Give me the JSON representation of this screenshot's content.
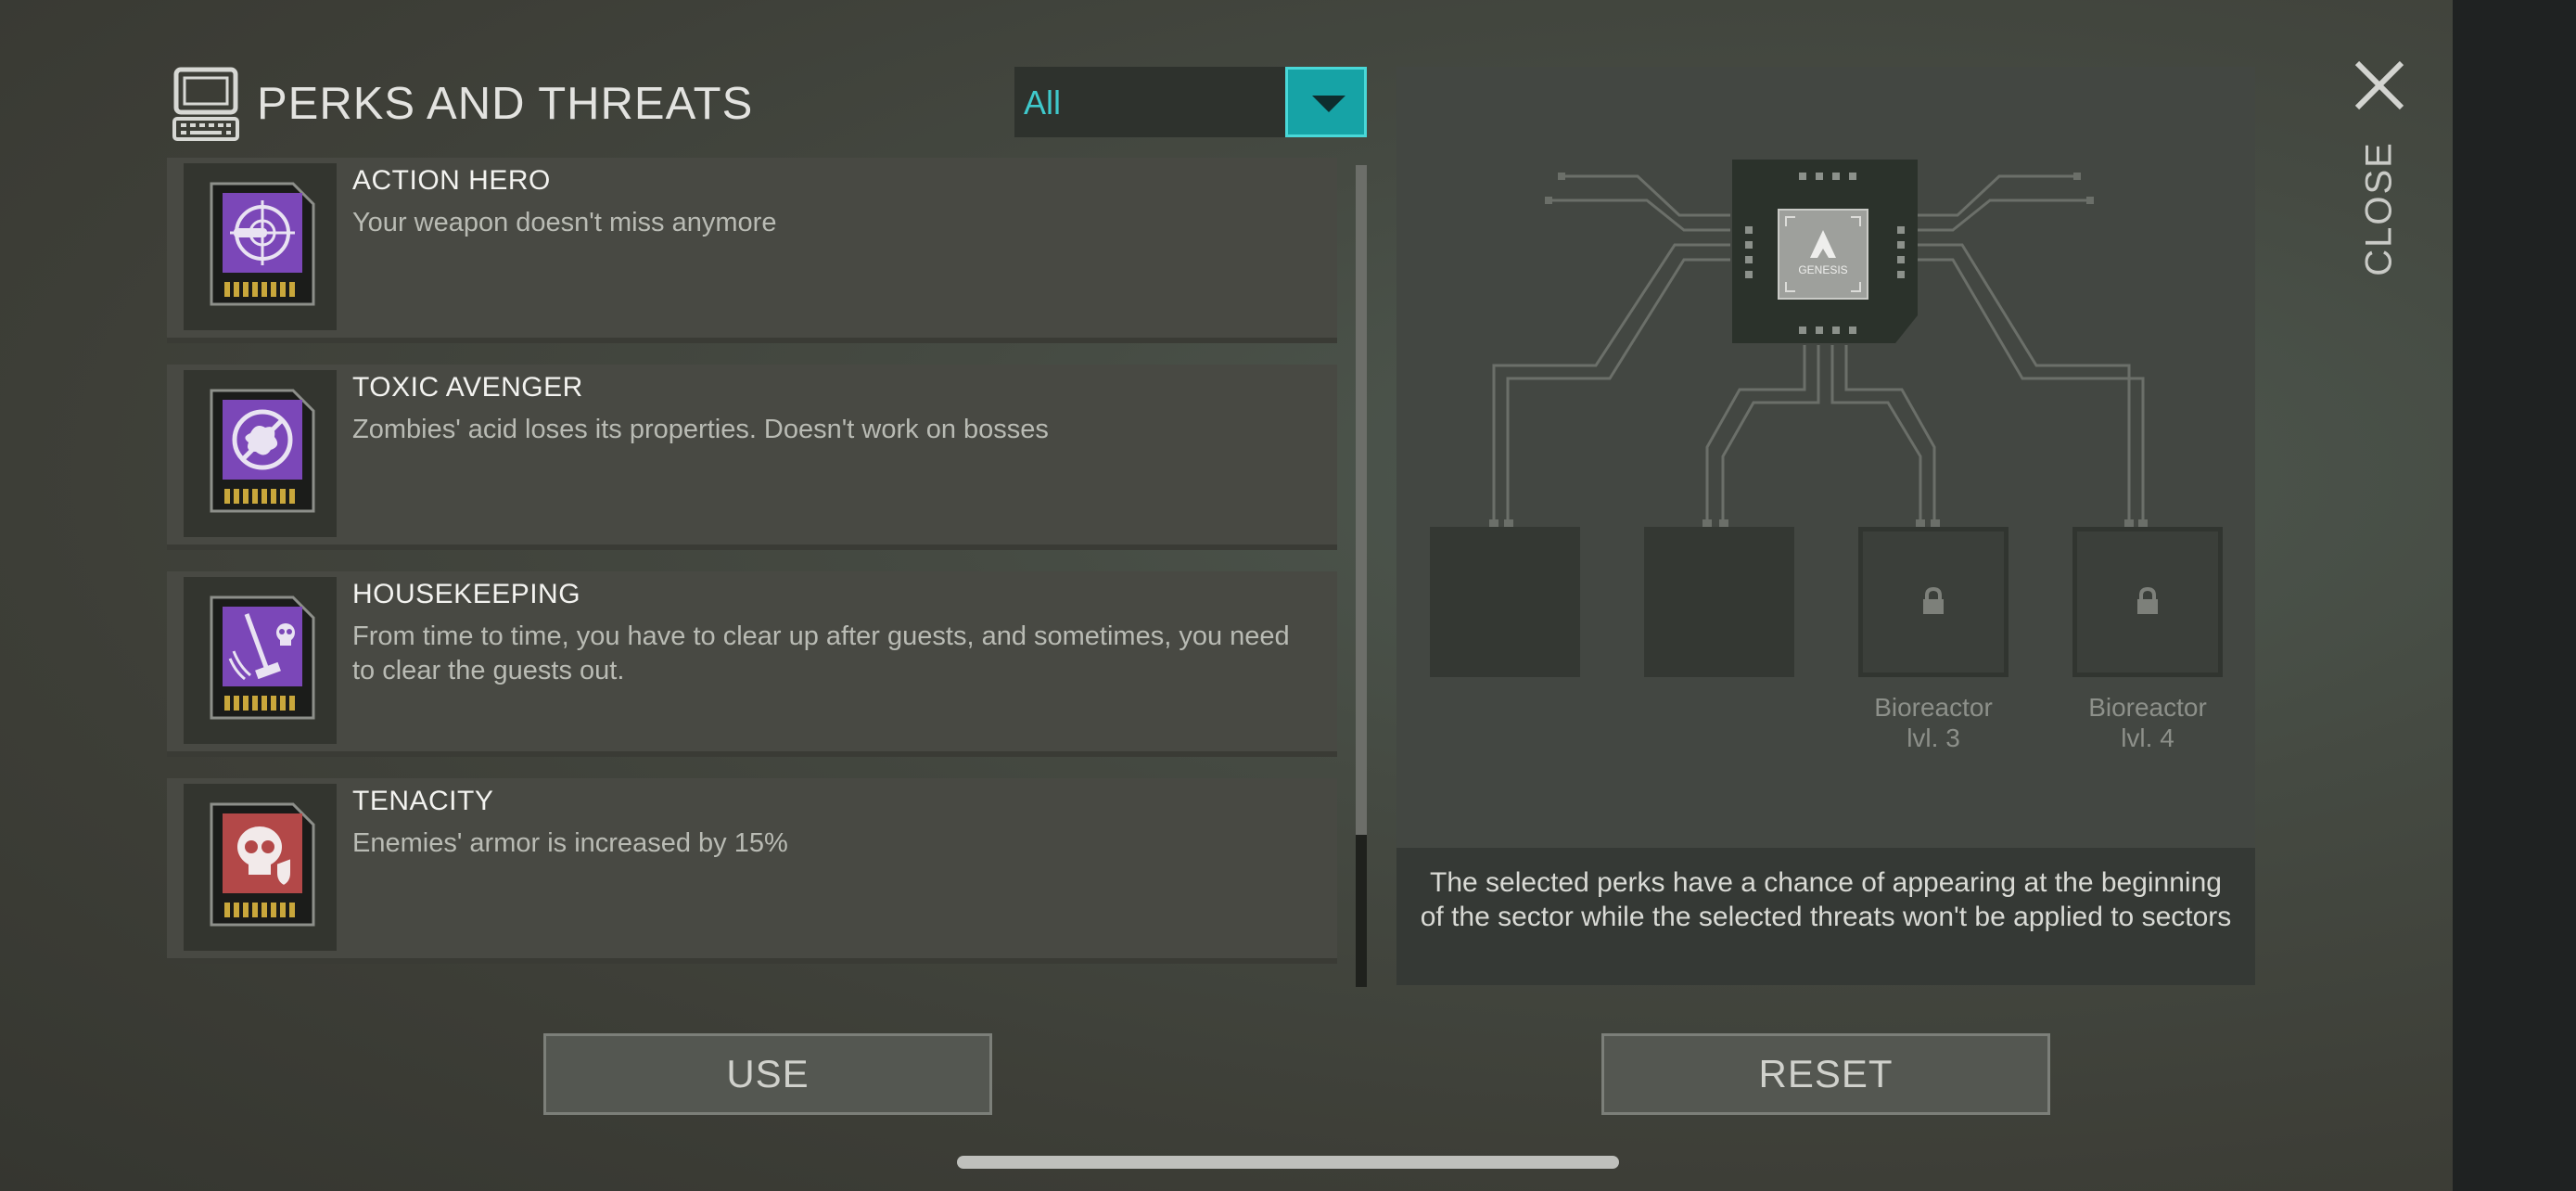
{
  "header": {
    "title": "PERKS AND THREATS"
  },
  "filter": {
    "selected": "All"
  },
  "perks": [
    {
      "name": "ACTION HERO",
      "description": "Your weapon doesn't miss anymore",
      "icon": "crosshair-bullet-icon",
      "card_color": "#7b47b8"
    },
    {
      "name": "TOXIC AVENGER",
      "description": "Zombies' acid loses its properties. Doesn't work on bosses",
      "icon": "acid-splash-blocked-icon",
      "card_color": "#7b47b8"
    },
    {
      "name": "HOUSEKEEPING",
      "description": "From time to time, you have to clear up after guests, and sometimes, you need to clear the guests out.",
      "icon": "mop-skull-icon",
      "card_color": "#7b47b8"
    },
    {
      "name": "TENACITY",
      "description": "Enemies' armor is increased by 15%",
      "icon": "skull-shield-icon",
      "card_color": "#b34848"
    }
  ],
  "panel": {
    "chip_label": "GENESIS",
    "slots": [
      {
        "locked": false,
        "label": ""
      },
      {
        "locked": false,
        "label": ""
      },
      {
        "locked": true,
        "label_line1": "Bioreactor",
        "label_line2": "lvl. 3"
      },
      {
        "locked": true,
        "label_line1": "Bioreactor",
        "label_line2": "lvl. 4"
      }
    ],
    "note": "The selected perks have a chance of appearing at the beginning of the sector while the selected threats won't be applied to sectors"
  },
  "close": {
    "label": "CLOSE"
  },
  "actions": {
    "use_label": "USE",
    "reset_label": "RESET"
  },
  "colors": {
    "accent": "#16a3a6",
    "accent_text": "#3fc9cc",
    "perk_card": "#7b47b8",
    "threat_card": "#b34848"
  }
}
